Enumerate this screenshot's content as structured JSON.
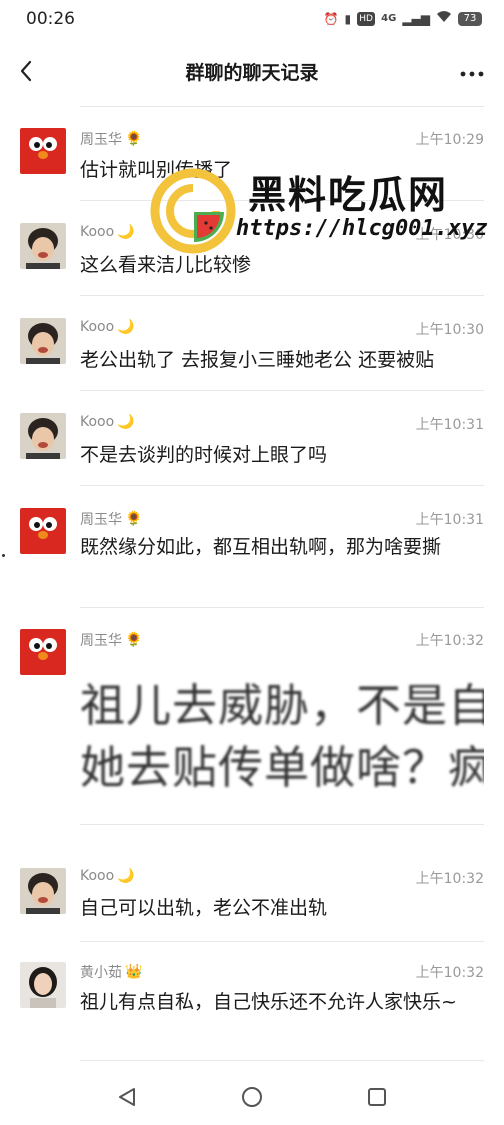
{
  "status_bar": {
    "time": "00:26",
    "net_label": "4G",
    "hd_label": "HD",
    "battery": "73"
  },
  "header": {
    "title": "群聊的聊天记录"
  },
  "watermark": {
    "title": "黑料吃瓜网",
    "url": "https://hlcg001.xyz"
  },
  "messages": [
    {
      "sender": "周玉华",
      "badge": "sunflower",
      "time": "上午10:29",
      "text": "估计就叫别传播了"
    },
    {
      "sender": "Kooo",
      "badge": "moon",
      "time": "上午10:30",
      "text": "这么看来洁儿比较惨"
    },
    {
      "sender": "Kooo",
      "badge": "moon",
      "time": "上午10:30",
      "text": "老公出轨了 去报复小三睡她老公 还要被贴"
    },
    {
      "sender": "Kooo",
      "badge": "moon",
      "time": "上午10:31",
      "text": "不是去谈判的时候对上眼了吗"
    },
    {
      "sender": "周玉华",
      "badge": "sunflower",
      "time": "上午10:31",
      "text": "既然缘分如此，都互相出轨啊，那为啥要撕"
    },
    {
      "sender": "周玉华",
      "badge": "sunflower",
      "time": "上午10:32",
      "line1": "祖儿去威胁，不是自",
      "line2": "她去贴传单做啥？疯"
    },
    {
      "sender": "Kooo",
      "badge": "moon",
      "time": "上午10:32",
      "text": "自己可以出轨，老公不准出轨"
    },
    {
      "sender": "黄小茹",
      "badge": "crown",
      "time": "上午10:32",
      "text": "祖儿有点自私，自己快乐还不允许人家快乐~"
    }
  ]
}
